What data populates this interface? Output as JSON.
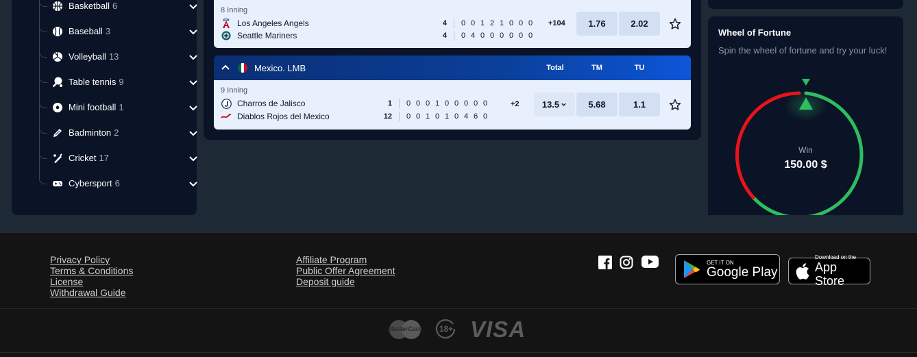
{
  "sidebar": {
    "items": [
      {
        "label": "Basketball",
        "count": "6",
        "icon": "basketball-icon"
      },
      {
        "label": "Baseball",
        "count": "3",
        "icon": "baseball-icon"
      },
      {
        "label": "Volleyball",
        "count": "13",
        "icon": "volleyball-icon"
      },
      {
        "label": "Table tennis",
        "count": "9",
        "icon": "table-tennis-icon"
      },
      {
        "label": "Mini football",
        "count": "1",
        "icon": "soccer-ball-icon"
      },
      {
        "label": "Badminton",
        "count": "2",
        "icon": "shuttlecock-icon"
      },
      {
        "label": "Cricket",
        "count": "17",
        "icon": "cricket-bat-icon"
      },
      {
        "label": "Cybersport",
        "count": "6",
        "icon": "gamepad-icon"
      }
    ]
  },
  "match1": {
    "period": "8 Inning",
    "team1": {
      "name": "Los Angeles Angels",
      "total": "4",
      "innings": [
        "0",
        "0",
        "1",
        "2",
        "1",
        "0",
        "0",
        "0"
      ]
    },
    "team2": {
      "name": "Seattle Mariners",
      "total": "4",
      "innings": [
        "0",
        "4",
        "0",
        "0",
        "0",
        "0",
        "0",
        "0"
      ]
    },
    "more": "+104",
    "odd1": "1.76",
    "odd2": "2.02"
  },
  "league": {
    "name": "Mexico. LMB",
    "flag_colors": [
      "#006847",
      "#ffffff",
      "#ce1126"
    ],
    "col_total": "Total",
    "col_tm": "TM",
    "col_tu": "TU"
  },
  "match2": {
    "period": "9 Inning",
    "team1": {
      "name": "Charros de Jalisco",
      "total": "1",
      "innings": [
        "0",
        "0",
        "0",
        "1",
        "0",
        "0",
        "0",
        "0",
        "0"
      ]
    },
    "team2": {
      "name": "Diablos Rojos del Mexico",
      "total": "12",
      "innings": [
        "0",
        "0",
        "1",
        "0",
        "1",
        "0",
        "4",
        "6",
        "0"
      ]
    },
    "more": "+2",
    "total_value": "13.5",
    "odd_tm": "5.68",
    "odd_tu": "1.1"
  },
  "wheel": {
    "title": "Wheel of Fortune",
    "subtitle": "Spin the wheel of fortune and try your luck!",
    "win_label": "Win",
    "win_value": "150.00 $",
    "colors": {
      "green": "#2ebd5f",
      "red": "#e8131b"
    }
  },
  "footer": {
    "col1": [
      "Privacy Policy",
      "Terms & Conditions",
      "License",
      "Withdrawal Guide"
    ],
    "col2": [
      "Affiliate Program",
      "Public Offer Agreement",
      "Deposit guide"
    ],
    "google_play": {
      "small": "GET IT ON",
      "big": "Google Play"
    },
    "app_store": {
      "small": "Download on the",
      "big": "App Store"
    },
    "payments": {
      "mastercard": "MasterCard",
      "age": "18+",
      "visa": "VISA"
    }
  },
  "colors": {
    "accent": "#0c56d8",
    "page_bg": "#1e2936",
    "panel_bg": "#0b1426",
    "card_bg": "#e8f0fd"
  }
}
